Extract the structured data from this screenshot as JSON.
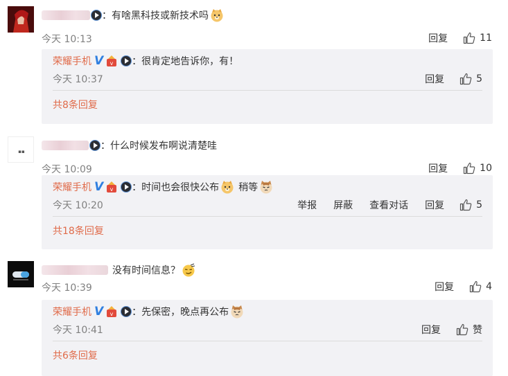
{
  "comments": [
    {
      "text": "：有啥黑科技或新技术吗",
      "time": "今天 10:13",
      "reply_label": "回复",
      "likes": "11",
      "emoji": "doge-emoji",
      "reply": {
        "author": "荣耀手机",
        "text": "：很肯定地告诉你，有！",
        "time": "今天 10:37",
        "reply_label": "回复",
        "likes": "5"
      },
      "more": "共8条回复"
    },
    {
      "text": "：什么时候发布啊说清楚哇",
      "time": "今天 10:09",
      "reply_label": "回复",
      "likes": "10",
      "reply": {
        "author": "荣耀手机",
        "text": "：时间也会很快公布",
        "text2": "稍等",
        "time": "今天 10:20",
        "report_label": "举报",
        "block_label": "屏蔽",
        "dialog_label": "查看对话",
        "reply_label": "回复",
        "likes": "5"
      },
      "more": "共18条回复"
    },
    {
      "text": "没有时间信息？",
      "time": "今天 10:39",
      "reply_label": "回复",
      "likes": "4",
      "reply": {
        "author": "荣耀手机",
        "text": "：先保密，晚点再公布",
        "time": "今天 10:41",
        "reply_label": "回复",
        "likes": "赞"
      },
      "more": "共6条回复"
    }
  ],
  "colors": {
    "accent": "#e06b4a",
    "verified_blue": "#2f7fe0",
    "reply_bg": "#f2f2f5",
    "muted": "#808080"
  },
  "icons": [
    "like-icon",
    "weibo-badge-icon",
    "verified-v-icon",
    "medal-icon",
    "doge-emoji",
    "cat-emoji",
    "smug-emoji"
  ]
}
